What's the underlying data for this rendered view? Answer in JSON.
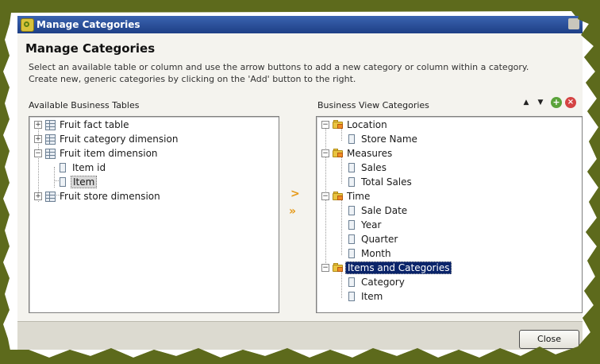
{
  "titlebar": {
    "title": "Manage Categories"
  },
  "dialog": {
    "heading": "Manage Categories",
    "description_line1": "Select an available table or column and use the arrow buttons to add a new category or column within a category.",
    "description_line2": "Create new, generic categories by clicking on the 'Add' button to the right."
  },
  "available": {
    "label": "Available Business Tables",
    "items": [
      {
        "label": "Fruit fact table",
        "expander": "+"
      },
      {
        "label": "Fruit category dimension",
        "expander": "+"
      },
      {
        "label": "Fruit item dimension",
        "expander": "−"
      },
      {
        "label": "Item id"
      },
      {
        "label": "Item"
      },
      {
        "label": "Fruit store dimension",
        "expander": "+"
      }
    ]
  },
  "arrows": {
    "add_one": ">",
    "add_all": "»"
  },
  "categories": {
    "label": "Business View Categories",
    "toolbar": {
      "up": "▲",
      "down": "▼",
      "add": "+",
      "delete": "×"
    },
    "items": [
      {
        "label": "Location",
        "expander": "−"
      },
      {
        "label": "Store Name"
      },
      {
        "label": "Measures",
        "expander": "−"
      },
      {
        "label": "Sales"
      },
      {
        "label": "Total Sales"
      },
      {
        "label": "Time",
        "expander": "−"
      },
      {
        "label": "Sale Date"
      },
      {
        "label": "Year"
      },
      {
        "label": "Quarter"
      },
      {
        "label": "Month"
      },
      {
        "label": "Items and Categories",
        "expander": "−"
      },
      {
        "label": "Category"
      },
      {
        "label": "Item"
      }
    ]
  },
  "footer": {
    "close_label": "Close"
  }
}
